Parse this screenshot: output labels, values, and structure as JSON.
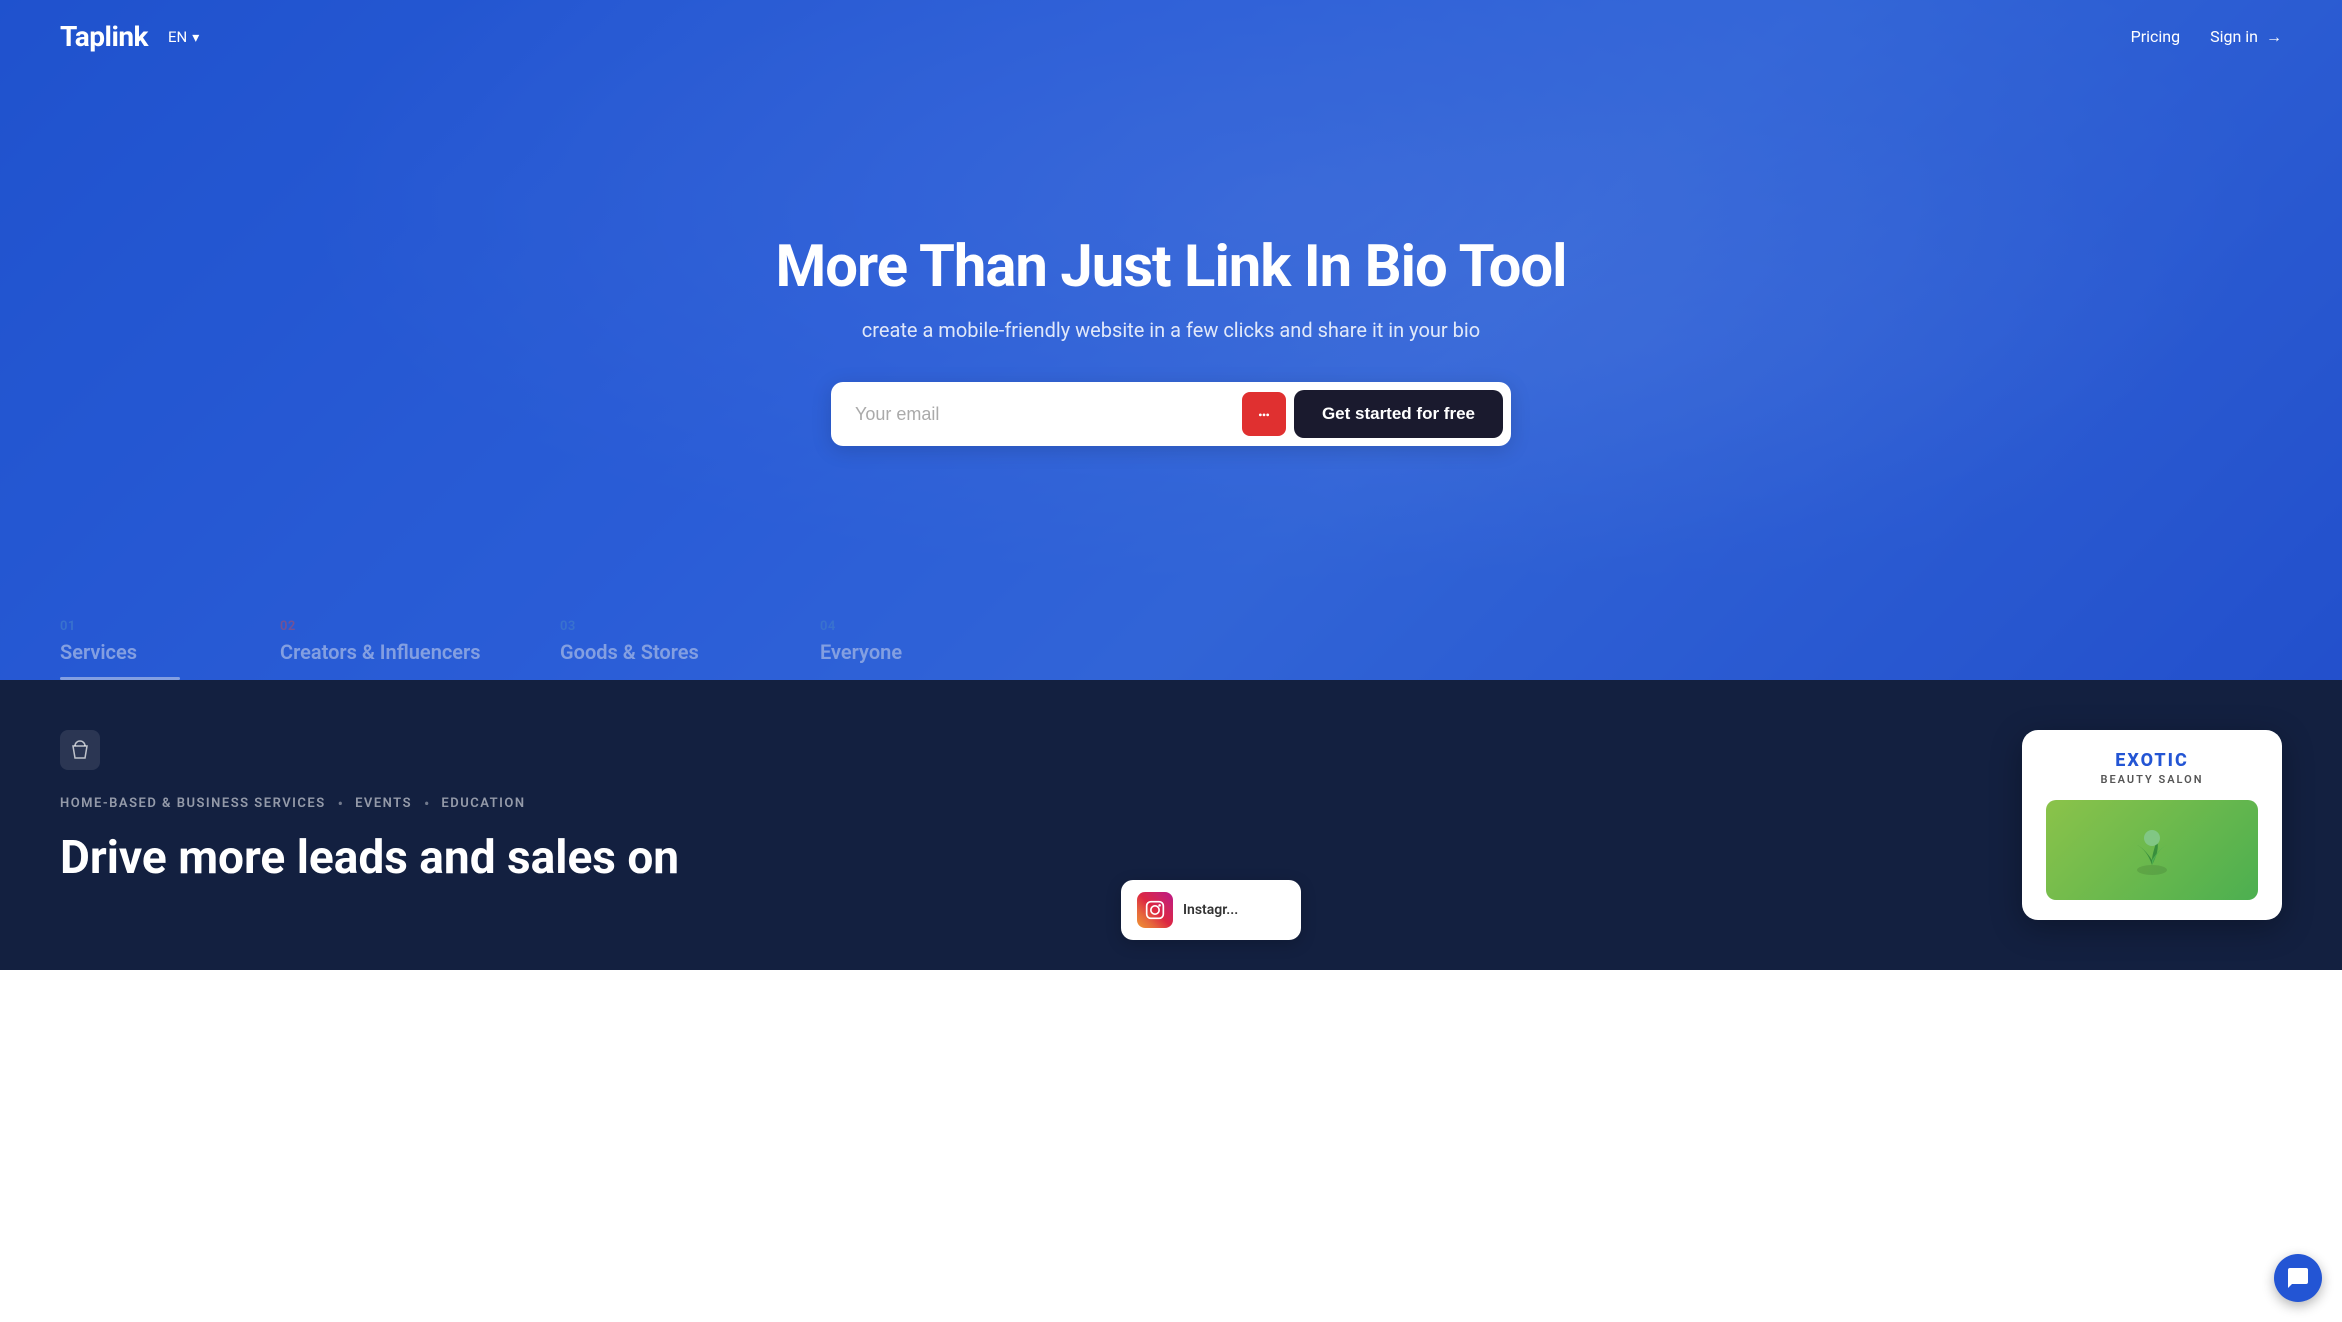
{
  "header": {
    "logo": "Taplink",
    "lang": "EN",
    "nav_pricing": "Pricing",
    "nav_signin": "Sign in"
  },
  "hero": {
    "title": "More Than Just Link In Bio Tool",
    "subtitle": "create a mobile-friendly website in a few clicks and share it in your bio",
    "email_placeholder": "Your email",
    "cta_button": "Get started for free"
  },
  "tabs": [
    {
      "number": "01",
      "label": "Services",
      "active": true
    },
    {
      "number": "02",
      "label": "Creators & Influencers",
      "active": false
    },
    {
      "number": "03",
      "label": "Goods & Stores",
      "active": false
    },
    {
      "number": "04",
      "label": "Everyone",
      "active": false
    }
  ],
  "content": {
    "tags": [
      "HOME-BASED & BUSINESS SERVICES",
      "EVENTS",
      "EDUCATION"
    ],
    "headline": "Drive more leads and sales on"
  },
  "exotic_card": {
    "title": "EXOTIC",
    "subtitle": "BEAUTY SALON"
  },
  "instagram_card": {
    "label": "Instagr..."
  },
  "chat_icon": "💬"
}
